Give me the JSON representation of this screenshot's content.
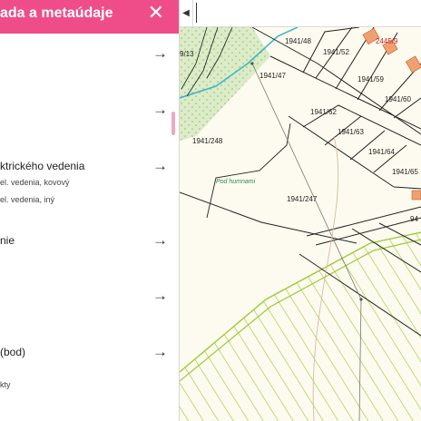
{
  "panel": {
    "title": "ada a metaúdaje",
    "close_icon": "close-icon",
    "rows": [
      {
        "label": "",
        "subs": []
      },
      {
        "label": "",
        "subs": []
      },
      {
        "label": "ktrického vedenia",
        "subs": [
          "el. vedenia, kovový",
          "el. vedenia, iný"
        ]
      },
      {
        "label": "nie",
        "subs": []
      },
      {
        "label": "",
        "subs": []
      },
      {
        "label": " (bod)",
        "subs": [
          "kty"
        ]
      }
    ],
    "arrow_icon": "arrow-right-icon"
  },
  "toolbar": {
    "collapse_icon": "chevron-left-icon",
    "search_value": "",
    "search_placeholder": ""
  },
  "map": {
    "parcels": [
      "1941/48",
      "1941/52",
      "1941/47",
      "1941/59",
      "1941/60",
      "1941/62",
      "1941/63",
      "1941/64",
      "1941/65",
      "1941/248",
      "1941/247",
      "2445/9",
      "9/13",
      "94"
    ],
    "place_name": "Pod humnami",
    "colors": {
      "header": "#ee4d8a",
      "map_bg": "#fdfbef",
      "forest": "#d9ebc4",
      "hatch": "#9bcb3b",
      "building": "#f0a070",
      "water": "#3fb7c9"
    }
  }
}
